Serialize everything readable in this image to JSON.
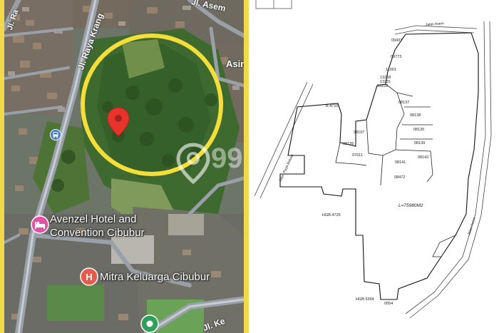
{
  "colors": {
    "highlight_ring": "#f5dd3a",
    "pin": "#e8332c",
    "hotel_marker": "#e54fa4",
    "hospital_marker": "#e85a4c",
    "transit_marker": "#4a7cc0",
    "park_marker": "#2fa05a",
    "frame": "#f2d94a"
  },
  "icons": [
    "location-pin-icon",
    "hotel-icon",
    "hospital-icon",
    "bus-icon",
    "park-icon",
    "watermark-icon"
  ],
  "map": {
    "streets": {
      "raya_krangan": "Jl. Raya Krang",
      "asem_top": "Jl. Asem",
      "asem_right": "Asin",
      "left_street": "Jl. Ra",
      "bottom_street": "Jl. Ke"
    },
    "poi": {
      "hotel_line1": "Avenzel Hotel and",
      "hotel_line2": "Convention Cibubur",
      "hospital": "Mitra Keluarga Cibubur"
    },
    "watermark": "99"
  },
  "plan": {
    "area_label": "L=75980M2",
    "road_left": "Jalan Raya Bekasi",
    "road_top": "Jalan Asem",
    "road_right": "Jalan Asem",
    "lots": {
      "b4710": "B.4710",
      "l09437": "09437",
      "l09773": "09773",
      "l11001": "11001",
      "l13258": "13258",
      "l13231": "13231",
      "l13232": "13232",
      "l08137": "08137",
      "l08138": "08138",
      "l08135": "08135",
      "l08139": "08139",
      "l08142": "08142",
      "l08197": "08197",
      "l08126": "08126",
      "l07611": "07611",
      "l08141": "08141",
      "l08472": "08472",
      "hgb4725": "HGB.4725",
      "hgb5364": "HGB.5364",
      "l0054": "0054"
    }
  }
}
